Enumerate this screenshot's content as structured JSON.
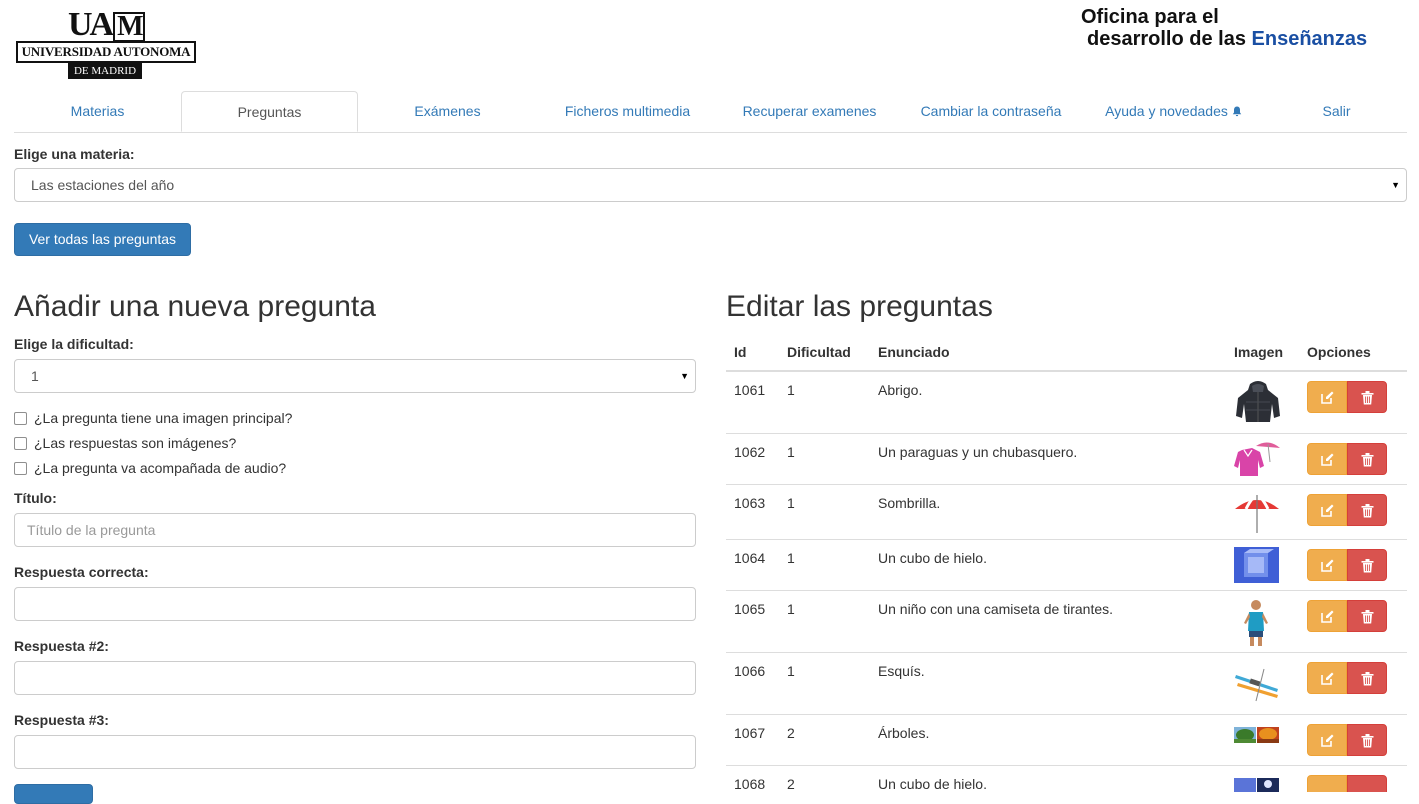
{
  "header": {
    "uam_monogram": "UAM",
    "uam_name": "UNIVERSIDAD AUTONOMA",
    "uam_sub": "DE MADRID",
    "ode_line1": "Oficina para el",
    "ode_line2_a": "desarrollo de las ",
    "ode_line2_b": "Enseñanzas"
  },
  "tabs": [
    {
      "label": "Materias"
    },
    {
      "label": "Preguntas",
      "active": true
    },
    {
      "label": "Exámenes"
    },
    {
      "label": "Ficheros multimedia"
    },
    {
      "label": "Recuperar examenes"
    },
    {
      "label": "Cambiar la contraseña"
    },
    {
      "label": "Ayuda y novedades",
      "icon": "bell-icon"
    },
    {
      "label": "Salir"
    }
  ],
  "materia": {
    "label": "Elige una materia:",
    "selected": "Las estaciones del año",
    "button": "Ver todas las preguntas"
  },
  "new_question": {
    "heading": "Añadir una nueva pregunta",
    "difficulty_label": "Elige la dificultad:",
    "difficulty_selected": "1",
    "checkboxes": [
      "¿La pregunta tiene una imagen principal?",
      "¿Las respuestas son imágenes?",
      "¿La pregunta va acompañada de audio?"
    ],
    "title_label": "Título:",
    "title_placeholder": "Título de la pregunta",
    "correct_label": "Respuesta correcta:",
    "answer2_label": "Respuesta #2:",
    "answer3_label": "Respuesta #3:"
  },
  "edit_questions": {
    "heading": "Editar las preguntas",
    "columns": [
      "Id",
      "Dificultad",
      "Enunciado",
      "Imagen",
      "Opciones"
    ],
    "rows": [
      {
        "id": "1061",
        "difficulty": "1",
        "statement": "Abrigo.",
        "image": "jacket-image"
      },
      {
        "id": "1062",
        "difficulty": "1",
        "statement": "Un paraguas y un chubasquero.",
        "image": "raincoat-umbrella-image"
      },
      {
        "id": "1063",
        "difficulty": "1",
        "statement": "Sombrilla.",
        "image": "beach-umbrella-image"
      },
      {
        "id": "1064",
        "difficulty": "1",
        "statement": "Un cubo de hielo.",
        "image": "ice-cube-image"
      },
      {
        "id": "1065",
        "difficulty": "1",
        "statement": "Un niño con una camiseta de tirantes.",
        "image": "child-tank-top-image"
      },
      {
        "id": "1066",
        "difficulty": "1",
        "statement": "Esquís.",
        "image": "skis-image"
      },
      {
        "id": "1067",
        "difficulty": "2",
        "statement": "Árboles.",
        "image": "trees-image"
      },
      {
        "id": "1068",
        "difficulty": "2",
        "statement": "Un cubo de hielo.",
        "image": "ice-cube-image-2"
      }
    ]
  },
  "colors": {
    "primary": "#337ab7",
    "edit": "#f0ad4e",
    "delete": "#d9534f",
    "link": "#337ab7"
  }
}
